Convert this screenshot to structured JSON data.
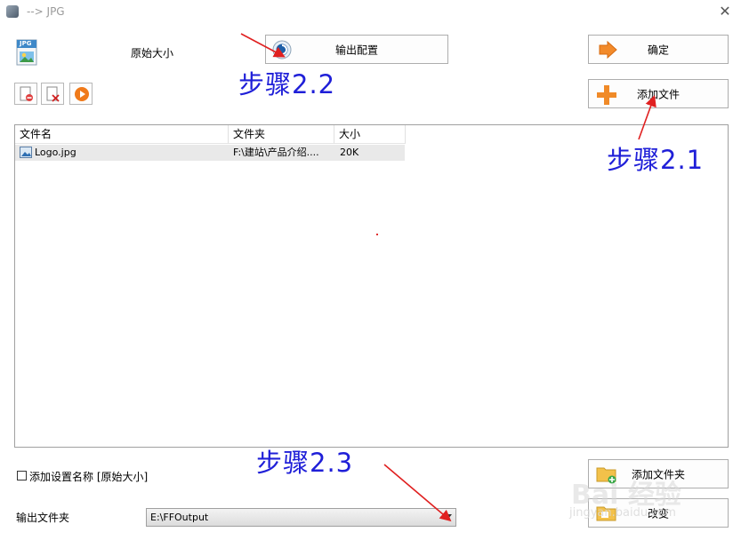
{
  "window": {
    "title": "--> JPG",
    "close_glyph": "✕"
  },
  "header": {
    "format_label": "原始大小",
    "jpg_badge": "JPG",
    "output_config_label": "输出配置"
  },
  "actions": {
    "ok_label": "确定",
    "add_file_label": "添加文件",
    "add_folder_label": "添加文件夹",
    "change_label": "改变"
  },
  "file_list": {
    "columns": [
      "文件名",
      "文件夹",
      "大小"
    ],
    "rows": [
      {
        "name": "Logo.jpg",
        "folder": "F:\\建站\\产品介绍....",
        "size": "20K"
      }
    ]
  },
  "options": {
    "add_setting_name_label": "添加设置名称 [原始大小]",
    "output_folder_label": "输出文件夹",
    "output_folder_value": "E:\\FFOutput"
  },
  "annotations": {
    "step_2_1": "步骤2.1",
    "step_2_2": "步骤2.2",
    "step_2_3": "步骤2.3",
    "arrow_color": "#e02020",
    "text_color": "#1f1fd8"
  },
  "watermark": {
    "line1": "Bai 经验",
    "line2": "jingyan.baidu.com"
  }
}
